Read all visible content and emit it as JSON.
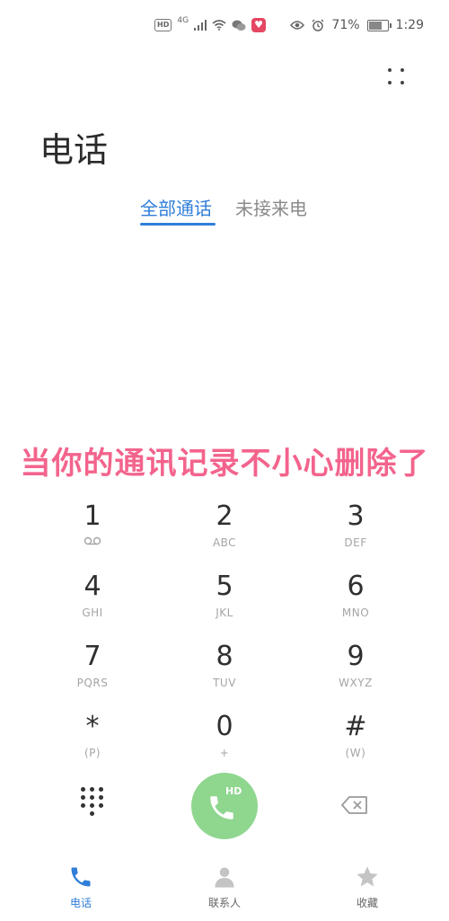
{
  "status_bar": {
    "hd_badge": "HD",
    "network_type": "4G",
    "battery_percent": "71%",
    "battery_level": 0.71,
    "time": "1:29"
  },
  "header": {
    "title": "电话"
  },
  "tabs": [
    {
      "label": "全部通话",
      "active": true
    },
    {
      "label": "未接来电",
      "active": false
    }
  ],
  "overlay_caption": "当你的通讯记录不小心删除了",
  "keypad": {
    "keys": [
      {
        "digit": "1",
        "letters": ""
      },
      {
        "digit": "2",
        "letters": "ABC"
      },
      {
        "digit": "3",
        "letters": "DEF"
      },
      {
        "digit": "4",
        "letters": "GHI"
      },
      {
        "digit": "5",
        "letters": "JKL"
      },
      {
        "digit": "6",
        "letters": "MNO"
      },
      {
        "digit": "7",
        "letters": "PQRS"
      },
      {
        "digit": "8",
        "letters": "TUV"
      },
      {
        "digit": "9",
        "letters": "WXYZ"
      },
      {
        "digit": "*",
        "letters": "(P)"
      },
      {
        "digit": "0",
        "letters": "+"
      },
      {
        "digit": "#",
        "letters": "(W)"
      }
    ]
  },
  "call_button": {
    "badge": "HD"
  },
  "bottom_nav": {
    "items": [
      {
        "label": "电话",
        "active": true
      },
      {
        "label": "联系人",
        "active": false
      },
      {
        "label": "收藏",
        "active": false
      }
    ]
  },
  "colors": {
    "accent": "#2f7ed8",
    "call_green": "#8fd68f",
    "caption_pink": "#f3648c",
    "inactive_gray": "#8a8a8a"
  }
}
